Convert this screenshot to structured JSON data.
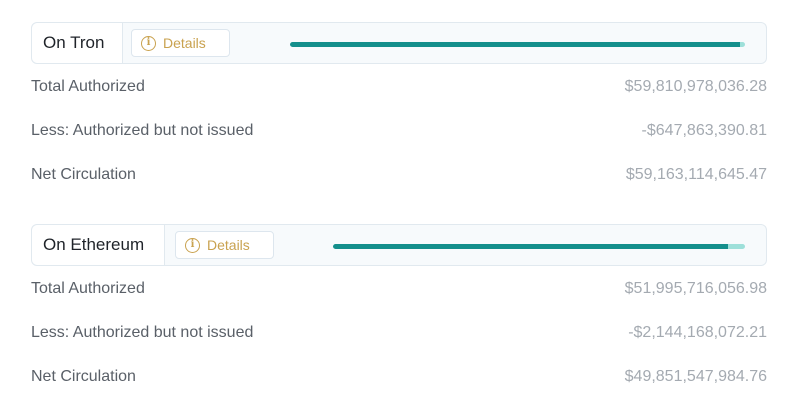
{
  "networks": [
    {
      "name": "On Tron",
      "details_label": "Details",
      "issued_fraction": 0.989,
      "rows": [
        {
          "label": "Total Authorized",
          "value": "$59,810,978,036.28"
        },
        {
          "label": "Less: Authorized but not issued",
          "value": "-$647,863,390.81"
        },
        {
          "label": "Net Circulation",
          "value": "$59,163,114,645.47"
        }
      ]
    },
    {
      "name": "On Ethereum",
      "details_label": "Details",
      "issued_fraction": 0.959,
      "rows": [
        {
          "label": "Total Authorized",
          "value": "$51,995,716,056.98"
        },
        {
          "label": "Less: Authorized but not issued",
          "value": "-$2,144,168,072.21"
        },
        {
          "label": "Net Circulation",
          "value": "$49,851,547,984.76"
        }
      ]
    }
  ],
  "icons": {
    "details": "info-icon"
  },
  "colors": {
    "bar_issued": "#148f8c",
    "bar_unissued": "#9ee0da",
    "details_accent": "#c9a24f"
  }
}
